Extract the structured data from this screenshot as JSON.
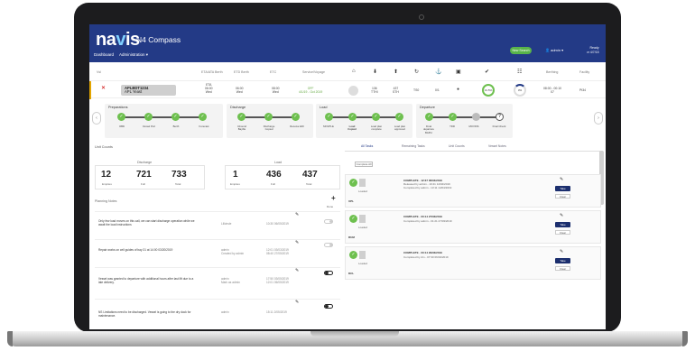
{
  "app": {
    "logo_text": "navis",
    "product": "N4 Compass",
    "menu": [
      "Dashboard",
      "Administration ▾"
    ],
    "new_button": "New Search",
    "user": "admin ▾",
    "version_top": "Ready",
    "version_bottom": "vr 4/7/15"
  },
  "columns": {
    "vessel": "Vsl",
    "eta": "ETA/ATA Berth",
    "etd": "ETD Berth",
    "status": "ETC",
    "service": "Service/Voyage",
    "moves": "Berthing",
    "facility": "Facility"
  },
  "vessel": {
    "flag": "✕",
    "name": "APLBDT1234",
    "sub": "APL Yeast",
    "eta": "ETA\n06:00\nWed",
    "etd": "06:00\nWed",
    "etc": "08:00\nWed",
    "service": "OFF\n4/1/19 - Oct 2019",
    "c1": "136\nTTHI",
    "c2": "437\nSTH",
    "c3": "TS0",
    "c4": "0/1",
    "progress": "31.5%",
    "berth": "08:00 - 00:10\n07",
    "pct2": "3%"
  },
  "stages": [
    {
      "title": "Preparations",
      "steps": [
        "OBD",
        "Vessel Port",
        "Berth",
        "Forecast"
      ]
    },
    {
      "title": "Discharge",
      "steps": [
        "Inbound\nBayfile",
        "Discharge\nCopied",
        "Receive EDI"
      ]
    },
    {
      "title": "Load",
      "steps": [
        "MOVPLE",
        "Load\nCopied",
        "Load plan\ncomplete",
        "Load plan\napproved"
      ]
    },
    {
      "title": "Departure",
      "steps": [
        "Final\ndeparture\nBAPLI",
        "TDR",
        "MOVINS",
        "Final Check"
      ]
    }
  ],
  "unit_counts": {
    "title": "Unit Counts",
    "discharge_title": "Discharge",
    "load_title": "Load",
    "discharge": [
      {
        "v": "12",
        "l": "Empties"
      },
      {
        "v": "721",
        "l": "Full"
      },
      {
        "v": "733",
        "l": "Total"
      }
    ],
    "load": [
      {
        "v": "1",
        "l": "Empties"
      },
      {
        "v": "436",
        "l": "Full"
      },
      {
        "v": "437",
        "l": "Total"
      }
    ]
  },
  "tabs": [
    "All Tasks",
    "Remaining Tasks",
    "Unit Counts",
    "Vessel Notes"
  ],
  "planning_notes": {
    "title": "Planning Notes",
    "header": "Done",
    "items": [
      {
        "text": "Only few load moves on this call, we can start discharge operation while we await the load instructions",
        "who": "Lilkinsle",
        "when": "10:30 06/05/2019"
      },
      {
        "text": "Repair works on cell guides of bay 31 at 14:00 03/20/2019",
        "who": "admin\nCreated by admin",
        "when": "12:01 03/03/2019\n08:40 27/05/2019"
      },
      {
        "text": "Vessel was granted to departure with additional hours after last lift due to a late delivery.",
        "who": "admin\nMark as admin",
        "when": "17:50 03/05/2019\n12:01 06/05/2019"
      },
      {
        "text": "NS Limitations need to be discharged. Vessel is going to the dry dock for maintenance.",
        "who": "admin",
        "when": "15:11 2/05/2019"
      }
    ]
  },
  "tasks": [
    {
      "code": "UPL",
      "lbl": "Loaded",
      "status": "COMPLETE - 12:37 06/04/2019",
      "sub": "Released by admin - 10:41 14/04/2019\nCompleted by admin - 13:11 14/04/2019",
      "btn": "Take",
      "btn2": "Clear"
    },
    {
      "code": "RUM",
      "lbl": "Loaded",
      "status": "COMPLETE - 00:14 27/03/2019",
      "sub": "Completed by admin - 01:21 27/03/2019",
      "btn": "Take",
      "btn2": "Clear"
    },
    {
      "code": "DCL",
      "lbl": "Loaded",
      "status": "COMPLETE - 00:14 29/03/2019",
      "sub": "Completed by dm - 07:30 06/04/2019",
      "btn": "Take",
      "btn2": "Clear"
    }
  ],
  "complete_all": "Complete All",
  "colors": {
    "brand": "#233a86",
    "accent": "#6ec04f"
  }
}
